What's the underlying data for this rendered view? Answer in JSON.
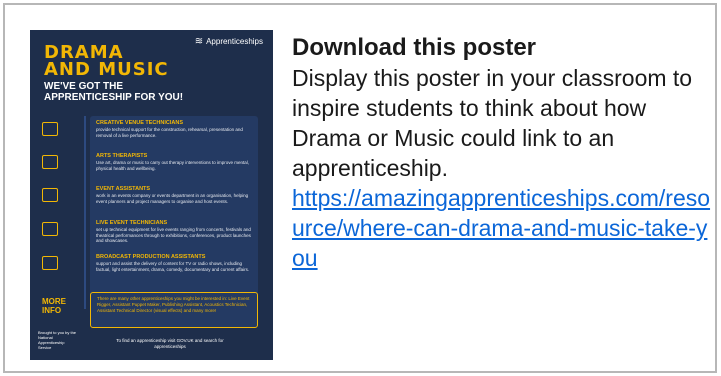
{
  "poster": {
    "logo_text": "Apprenticeships",
    "title_line1": "DRAMA",
    "title_line2": "AND MUSIC",
    "subtitle_line1": "WE'VE GOT THE",
    "subtitle_line2": "APPRENTICESHIP FOR YOU!",
    "items": [
      {
        "heading": "CREATIVE VENUE TECHNICIANS",
        "body": "provide technical support for the construction, rehearsal, presentation and removal of a live performance.",
        "icon": "theatre-icon"
      },
      {
        "heading": "ARTS THERAPISTS",
        "body": "Use art, drama or music to carry out therapy interventions to improve mental, physical health and wellbeing.",
        "icon": "easel-icon"
      },
      {
        "heading": "EVENT ASSISTANTS",
        "body": "work in an events company or events department in an organisation, helping event planners and project managers to organise and host events.",
        "icon": "calendar-icon"
      },
      {
        "heading": "LIVE EVENT TECHNICIANS",
        "body": "set up technical equipment for live events ranging from concerts, festivals and theatrical performances through to exhibitions, conferences, product launches and showcases.",
        "icon": "stage-lights-icon"
      },
      {
        "heading": "BROADCAST PRODUCTION ASSISTANTS",
        "body": "support and assist the delivery of content for TV or radio shows, including factual, light entertainment, drama, comedy, documentary and current affairs.",
        "icon": "camera-icon"
      }
    ],
    "more_label_line1": "MORE",
    "more_label_line2": "INFO",
    "more_text": "There are many other apprenticeships you might be interested in: Live Event Rigger, Assistant Puppet Maker, Publishing Assistant, Acoustics Technician, Assistant Technical Director (visual effects) and many more!",
    "footer_left": "Brought to you by the National Apprenticeship Service",
    "footer": "To find an apprenticeship visit GOV.UK and search for apprenticeships"
  },
  "heading": "Download this poster",
  "description": "Display this poster in your classroom to inspire students to think about how Drama or Music could link to an apprenticeship.",
  "link": "https://amazingapprenticeships.com/resource/where-can-drama-and-music-take-you",
  "colors": {
    "navy": "#1e2e4b",
    "yellow": "#f2b705",
    "link": "#0b66d8",
    "border": "#b7b7b7"
  }
}
